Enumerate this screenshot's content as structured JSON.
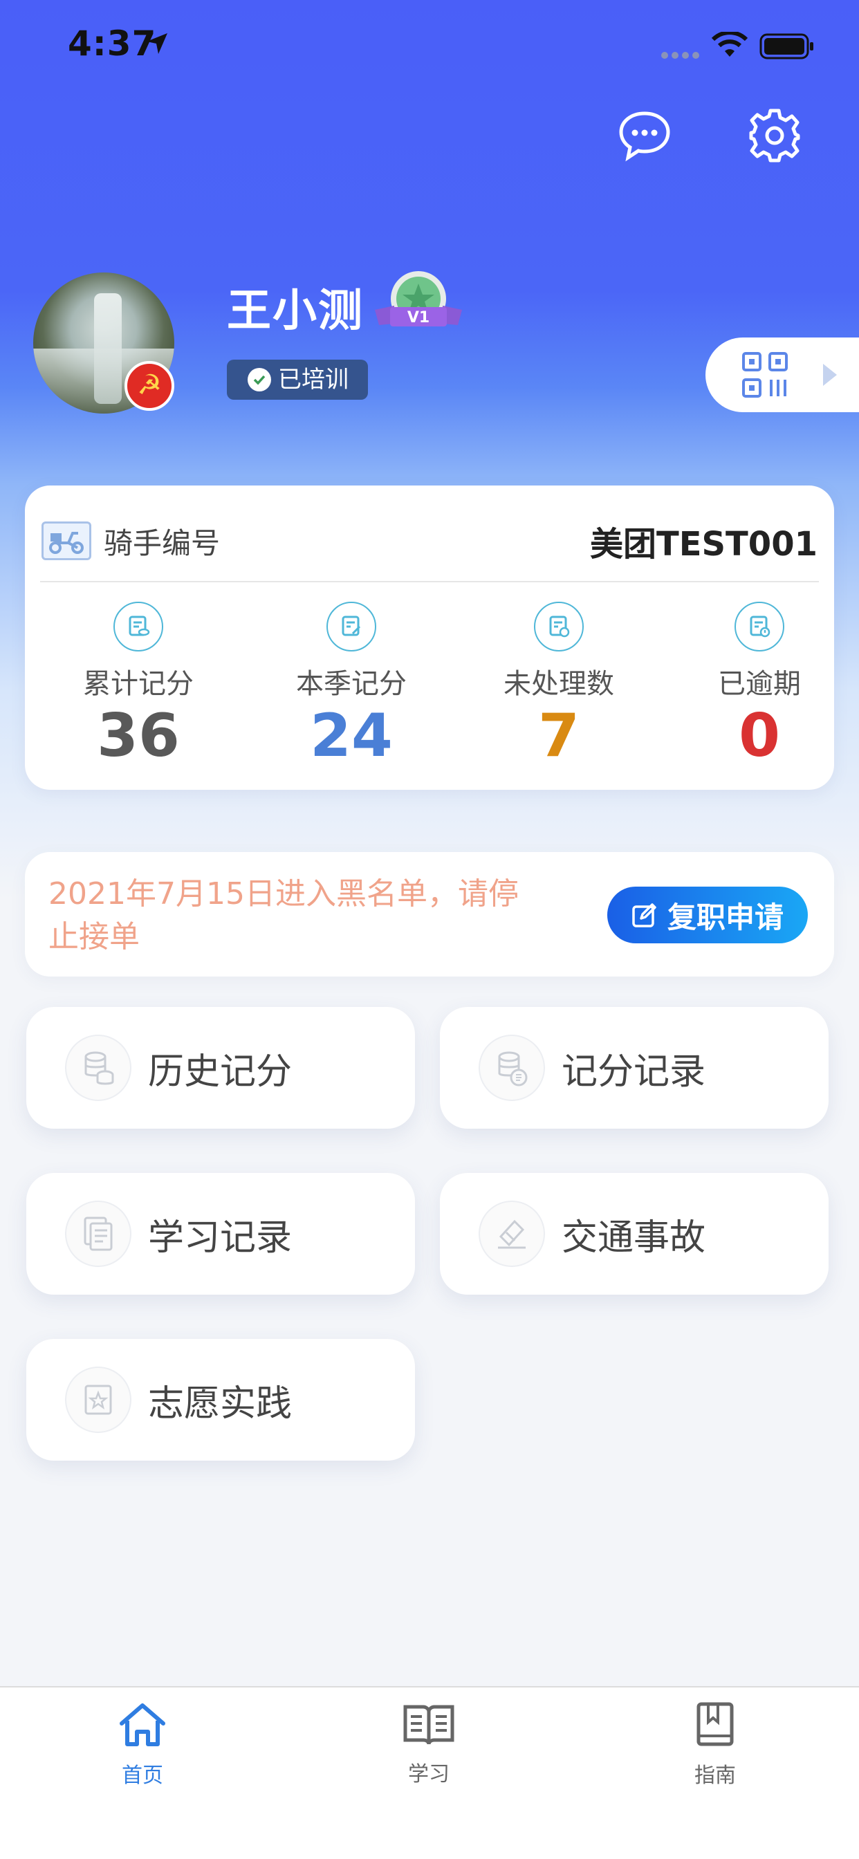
{
  "status_bar": {
    "time": "4:37"
  },
  "profile": {
    "name": "王小测",
    "level": "V1",
    "trained_label": "已培训"
  },
  "rider": {
    "label": "骑手编号",
    "id": "美团TEST001",
    "stats": [
      {
        "label": "累计记分",
        "value": "36",
        "color": "#595959"
      },
      {
        "label": "本季记分",
        "value": "24",
        "color": "#4a7fd6"
      },
      {
        "label": "未处理数",
        "value": "7",
        "color": "#d98a12"
      },
      {
        "label": "已逾期",
        "value": "0",
        "color": "#d93232"
      }
    ]
  },
  "notice": {
    "text": "2021年7月15日进入黑名单，请停止接单",
    "button_label": "复职申请"
  },
  "menu": [
    {
      "label": "历史记分",
      "icon": "database-icon"
    },
    {
      "label": "记分记录",
      "icon": "record-icon"
    },
    {
      "label": "学习记录",
      "icon": "document-icon"
    },
    {
      "label": "交通事故",
      "icon": "accident-icon"
    },
    {
      "label": "志愿实践",
      "icon": "star-frame-icon"
    }
  ],
  "tabbar": [
    {
      "label": "首页",
      "icon": "home-icon",
      "active": true
    },
    {
      "label": "学习",
      "icon": "book-icon",
      "active": false
    },
    {
      "label": "指南",
      "icon": "guide-icon",
      "active": false
    }
  ],
  "colors": {
    "primary": "#4a5ff8",
    "active_tab": "#2f7de1",
    "inactive_tab": "#666666"
  }
}
